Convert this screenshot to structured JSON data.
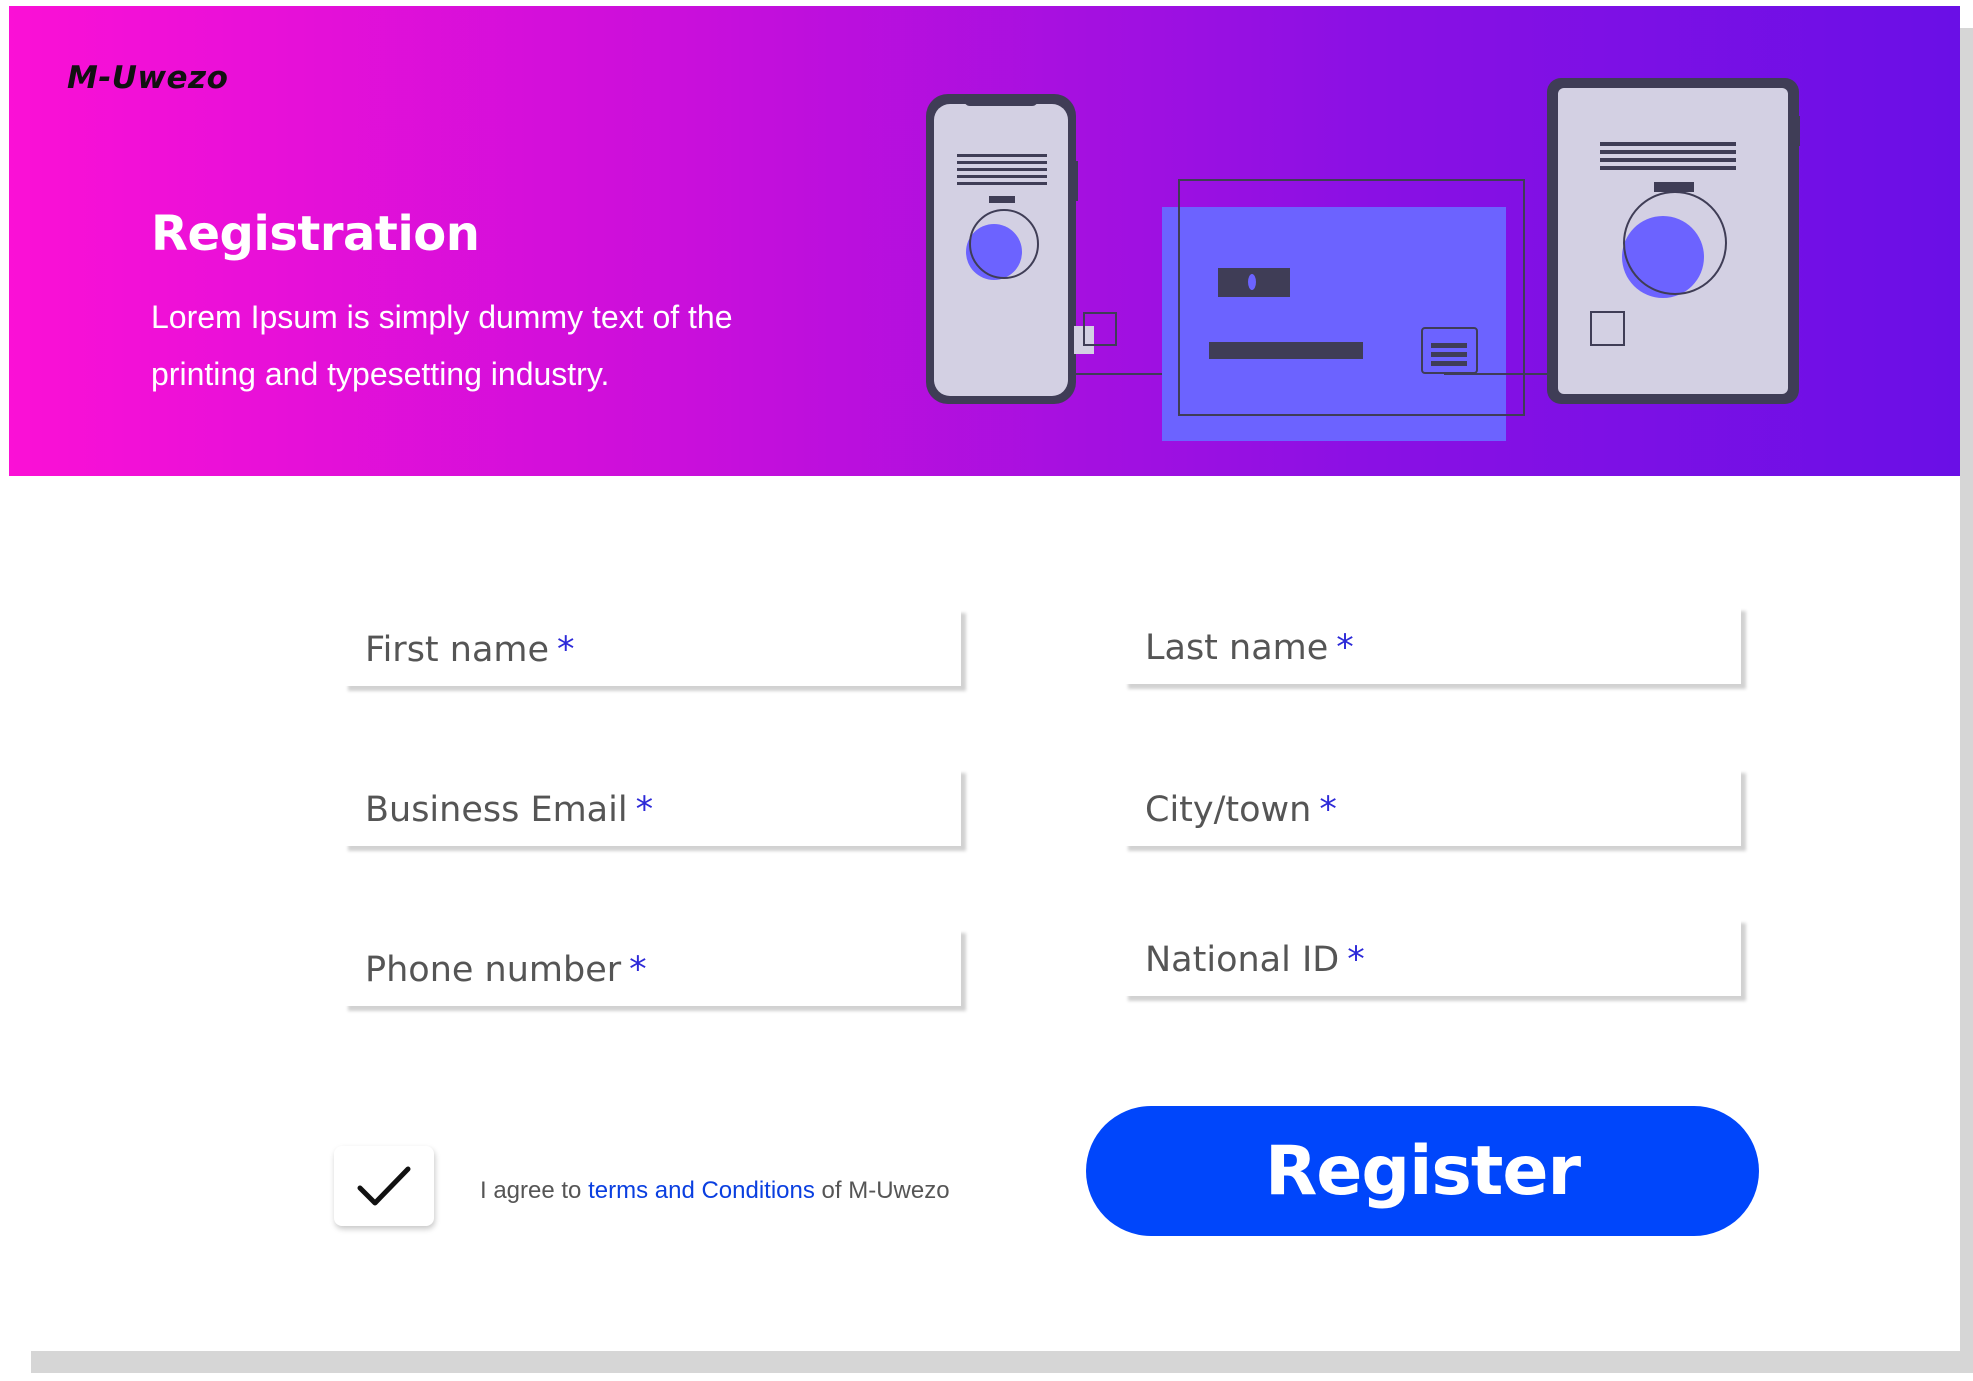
{
  "brand": "M-Uwezo",
  "header": {
    "title": "Registration",
    "subtitle": "Lorem Ipsum is simply dummy text of the printing and typesetting industry."
  },
  "form": {
    "required_mark": "*",
    "fields": {
      "first_name": "First name",
      "last_name": "Last name",
      "business_email": "Business Email",
      "city_town": "City/town",
      "phone_number": "Phone number",
      "national_id": "National ID"
    },
    "agreement": {
      "checked": true,
      "prefix": "I agree to",
      "link": "terms and Conditions",
      "suffix": "of M-Uwezo"
    },
    "submit_label": "Register"
  },
  "colors": {
    "gradient_start": "#fb10d6",
    "gradient_end": "#6a0fe6",
    "accent": "#0046fb",
    "required": "#2d2ad8",
    "illustration_purple": "#6c63ff"
  },
  "icons": {
    "checkbox": "checkmark-icon",
    "illustration": "devices-illustration"
  }
}
